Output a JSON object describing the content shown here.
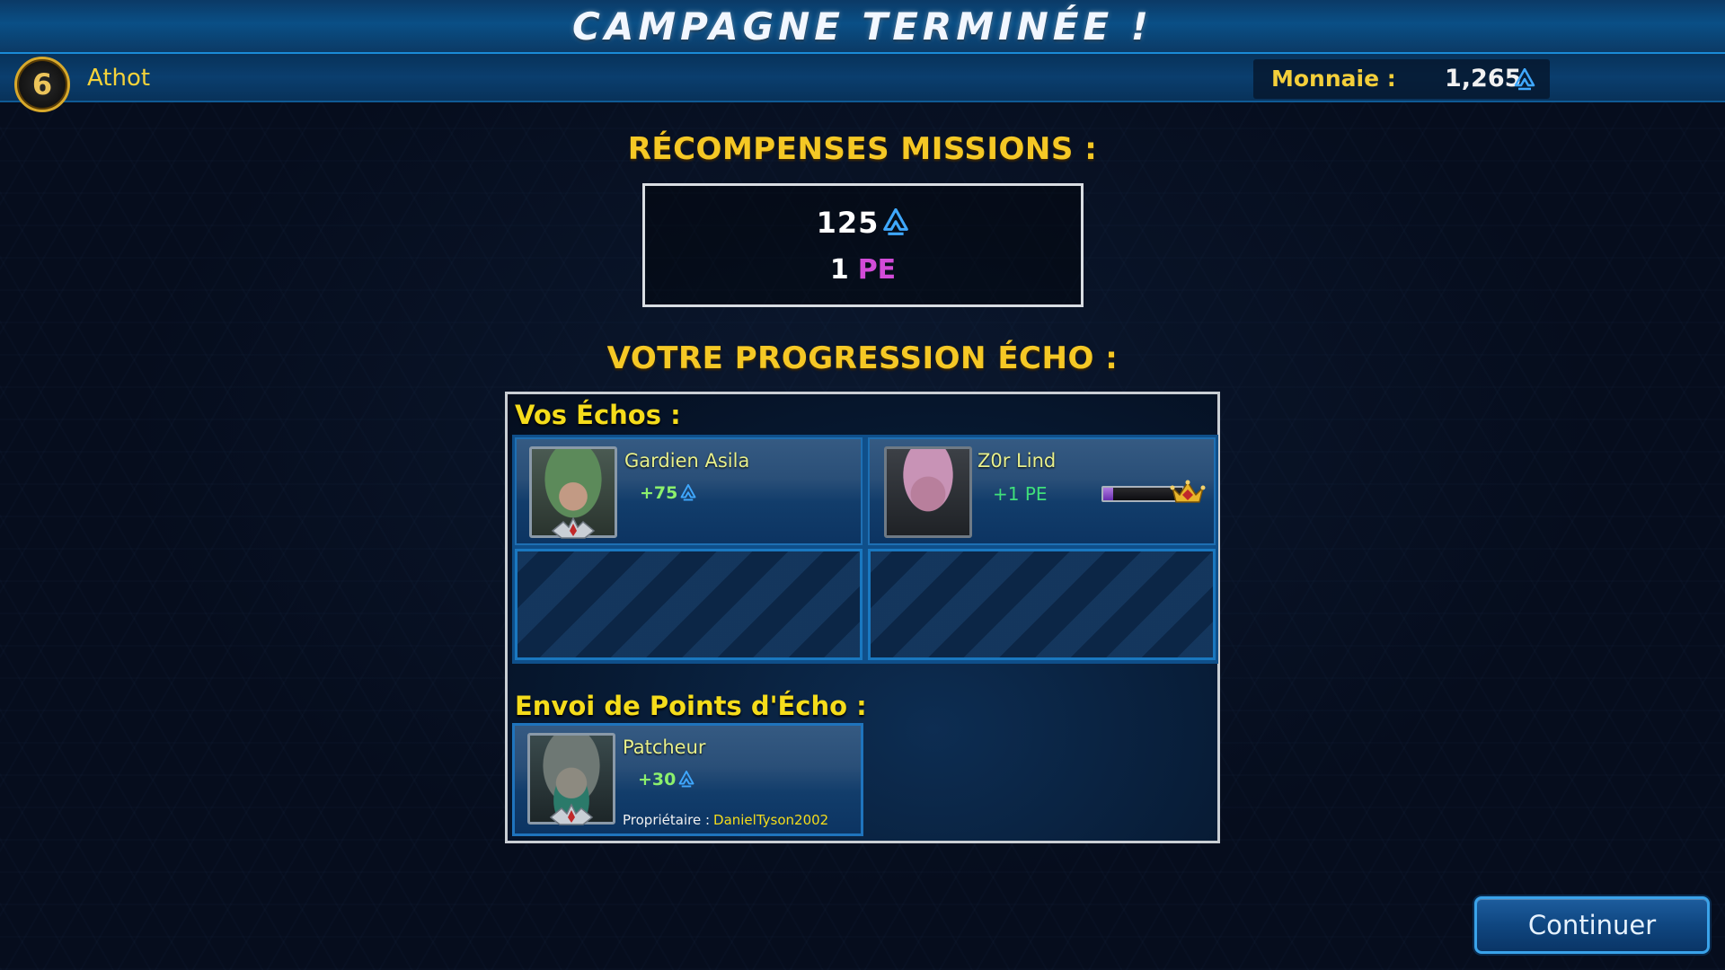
{
  "header": {
    "title": "CAMPAGNE TERMINÉE !"
  },
  "player": {
    "level": "6",
    "name": "Athot"
  },
  "currency": {
    "label": "Monnaie :",
    "value": "1,265",
    "icon": "credits-icon",
    "color": "#3fa8ff"
  },
  "rewards": {
    "heading": "RÉCOMPENSES MISSIONS :",
    "credits": "125",
    "pe_amount": "1",
    "pe_label": "PE",
    "pe_color": "#d24bd8"
  },
  "progression": {
    "heading": "VOTRE PROGRESSION ÉCHO :",
    "your_echoes_heading": "Vos Échos :",
    "echoes": [
      {
        "name": "Gardien Asila",
        "reward": "+75",
        "reward_type": "credits"
      },
      {
        "name": "Z0r Lind",
        "reward": "+1 PE",
        "reward_type": "pe",
        "pe_progress": 0.12,
        "icon": "crown-icon"
      }
    ],
    "send_heading": "Envoi de Points d'Écho :",
    "sent": {
      "name": "Patcheur",
      "reward": "+30",
      "owner_label": "Propriétaire :",
      "owner_name": "DanielTyson2002"
    }
  },
  "actions": {
    "continue_label": "Continuer"
  },
  "colors": {
    "heading_gold": "#f5c825",
    "subheading_yellow": "#f5dc1b",
    "accent_blue": "#1a8ad6"
  }
}
